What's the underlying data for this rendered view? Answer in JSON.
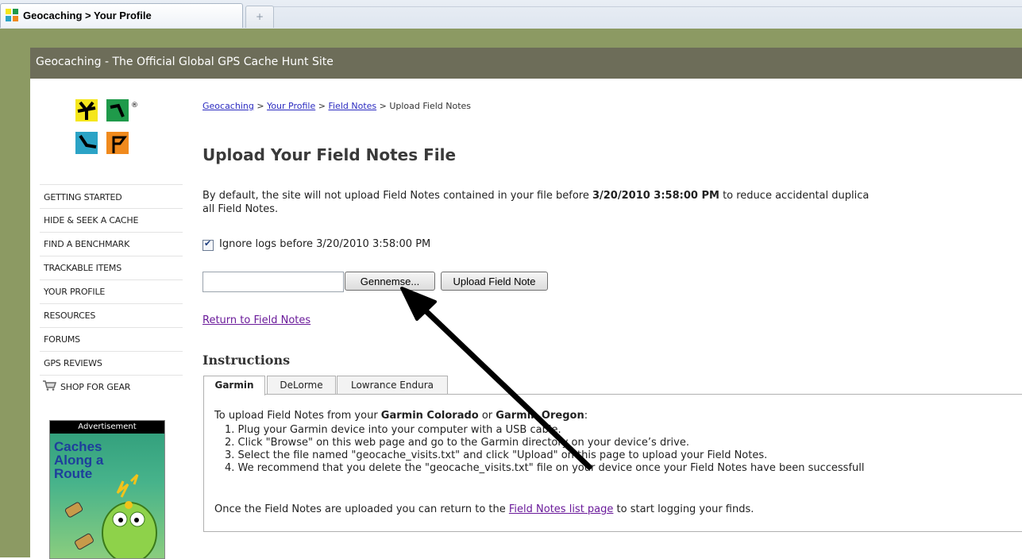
{
  "browser": {
    "tab_title": "Geocaching > Your Profile",
    "new_tab_glyph": "+"
  },
  "header": {
    "title": "Geocaching - The Official Global GPS Cache Hunt Site"
  },
  "logo": {
    "registered_mark": "®",
    "colors": [
      "#f5e61c",
      "#1f9a4a",
      "#2ba3c6",
      "#f08a1d"
    ]
  },
  "sidebar": {
    "items": [
      {
        "label": "GETTING STARTED"
      },
      {
        "label": "HIDE & SEEK A CACHE"
      },
      {
        "label": "FIND A BENCHMARK"
      },
      {
        "label": "TRACKABLE ITEMS"
      },
      {
        "label": "YOUR PROFILE"
      },
      {
        "label": "RESOURCES"
      },
      {
        "label": "FORUMS"
      },
      {
        "label": "GPS REVIEWS"
      },
      {
        "label": "SHOP FOR GEAR",
        "icon": "cart-icon"
      }
    ]
  },
  "ad": {
    "label": "Advertisement",
    "headline_1": "Caches",
    "headline_2": "Along a",
    "headline_3": "Route"
  },
  "breadcrumb": {
    "item_1": "Geocaching",
    "sep": ">",
    "item_2": "Your Profile",
    "item_3": "Field Notes",
    "item_4": "Upload Field Notes"
  },
  "main": {
    "title": "Upload Your Field Notes File",
    "intro_before": "By default, the site will not upload Field Notes contained in your file before ",
    "intro_date": "3/20/2010 3:58:00 PM",
    "intro_after": " to reduce accidental duplica",
    "intro_line2": "all Field Notes.",
    "ignore_checked": true,
    "ignore_label": "Ignore logs before 3/20/2010 3:58:00 PM",
    "file_input_value": "",
    "browse_label": "Gennemse...",
    "upload_label": "Upload Field Note",
    "return_link": "Return to Field Notes",
    "instructions_heading": "Instructions"
  },
  "instructions": {
    "tabs": [
      {
        "label": "Garmin",
        "active": true
      },
      {
        "label": "DeLorme",
        "active": false
      },
      {
        "label": "Lowrance Endura",
        "active": false
      }
    ],
    "intro_a": "To upload Field Notes from your ",
    "intro_b": "Garmin Colorado",
    "intro_c": " or ",
    "intro_d": "Garmin Oregon",
    "intro_e": ":",
    "steps": [
      "1. Plug your Garmin device into your computer with a USB cable.",
      "2. Click \"Browse\" on this web page and go to the Garmin directory on your device’s drive.",
      "3. Select the file named \"geocache_visits.txt\" and click \"Upload\" on this page to upload your Field Notes.",
      "4. We recommend that you delete the \"geocache_visits.txt\" file on your device once your Field Notes have been successfull"
    ],
    "outro_a": "Once the Field Notes are uploaded you can return to the ",
    "outro_link": "Field Notes list page",
    "outro_b": " to start logging your finds."
  },
  "colors": {
    "frame": "#8c9a63",
    "header_bar": "#6d6d59",
    "link": "#2b2bc0",
    "visited_link": "#6a1a9a",
    "annotation_arrow": "#000000"
  }
}
